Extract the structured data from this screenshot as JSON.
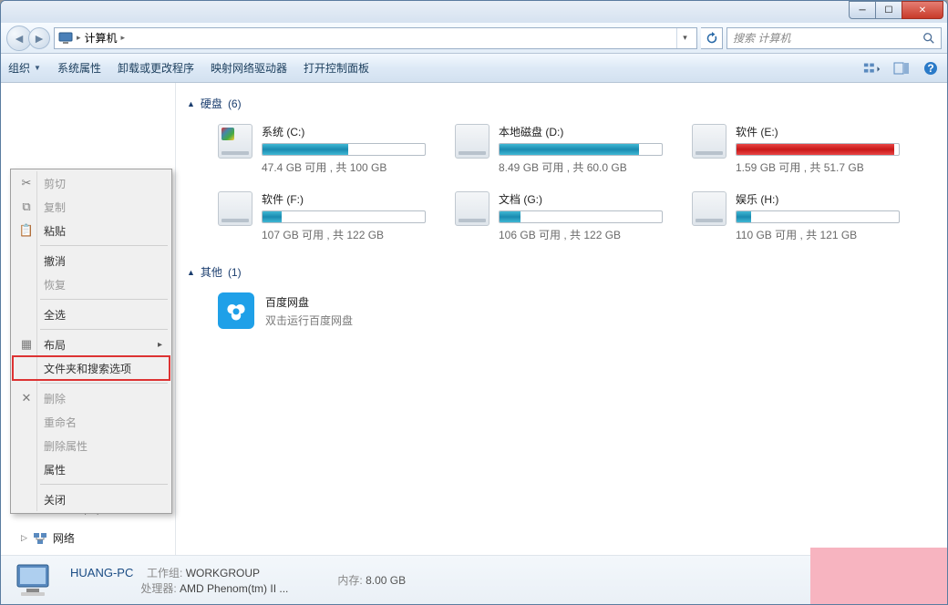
{
  "breadcrumb": {
    "root": "计算机",
    "sep": "▸"
  },
  "search": {
    "placeholder": "搜索 计算机"
  },
  "toolbar": {
    "organize": "组织",
    "system_props": "系统属性",
    "uninstall": "卸载或更改程序",
    "map_drive": "映射网络驱动器",
    "control_panel": "打开控制面板"
  },
  "dropdown": {
    "cut": "剪切",
    "copy": "复制",
    "paste": "粘贴",
    "undo": "撤消",
    "redo": "恢复",
    "select_all": "全选",
    "layout": "布局",
    "folder_options": "文件夹和搜索选项",
    "delete": "删除",
    "rename": "重命名",
    "remove_props": "删除属性",
    "properties": "属性",
    "close": "关闭"
  },
  "sidebar": {
    "system_c": "系统 (C:)",
    "local_d": "本地磁盘 (D:)",
    "software_e": "软件 (E:)",
    "software_f": "软件 (F:)",
    "docs_g": "文档 (G:)",
    "ent_h": "娱乐 (H:)",
    "network": "网络"
  },
  "groups": {
    "drives": {
      "label": "硬盘",
      "count": "(6)"
    },
    "other": {
      "label": "其他",
      "count": "(1)"
    }
  },
  "drives": [
    {
      "name": "系统 (C:)",
      "sub": "47.4 GB 可用 , 共 100 GB",
      "fill": 53,
      "color": "blue",
      "system": true
    },
    {
      "name": "本地磁盘 (D:)",
      "sub": "8.49 GB 可用 , 共 60.0 GB",
      "fill": 86,
      "color": "blue",
      "system": false
    },
    {
      "name": "软件 (E:)",
      "sub": "1.59 GB 可用 , 共 51.7 GB",
      "fill": 97,
      "color": "red",
      "system": false
    },
    {
      "name": "软件 (F:)",
      "sub": "107 GB 可用 , 共 122 GB",
      "fill": 12,
      "color": "blue",
      "system": false
    },
    {
      "name": "文档 (G:)",
      "sub": "106 GB 可用 , 共 122 GB",
      "fill": 13,
      "color": "blue",
      "system": false
    },
    {
      "name": "娱乐 (H:)",
      "sub": "110 GB 可用 , 共 121 GB",
      "fill": 9,
      "color": "blue",
      "system": false
    }
  ],
  "other": {
    "name": "百度网盘",
    "sub": "双击运行百度网盘"
  },
  "status": {
    "name": "HUANG-PC",
    "workgroup_label": "工作组:",
    "workgroup": "WORKGROUP",
    "cpu_label": "处理器:",
    "cpu": "AMD Phenom(tm) II ...",
    "mem_label": "内存:",
    "mem": "8.00 GB"
  }
}
